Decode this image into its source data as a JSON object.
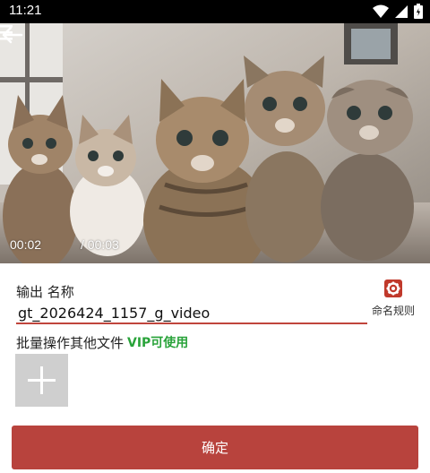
{
  "status_bar": {
    "time": "11:21",
    "icons": [
      "wifi-icon",
      "signal-icon",
      "battery-icon"
    ]
  },
  "player": {
    "current_time": "00:02",
    "total_time": "/ 00:03",
    "back_icon": "arrow-left-icon",
    "menu_icon": "menu-icon"
  },
  "output": {
    "label": "输出 名称",
    "filename": "gt_2026424_1157_g_video",
    "rules_label": "命名规则",
    "rules_icon": "gear-icon"
  },
  "batch": {
    "label": "批量操作其他文件",
    "vip_label": "VIP可使用",
    "add_icon": "plus-icon"
  },
  "confirm_label": "确定",
  "colors": {
    "accent": "#b8433d",
    "underline": "#c0453c",
    "vip": "#29a33a",
    "add_tile": "#cfcfcf"
  }
}
